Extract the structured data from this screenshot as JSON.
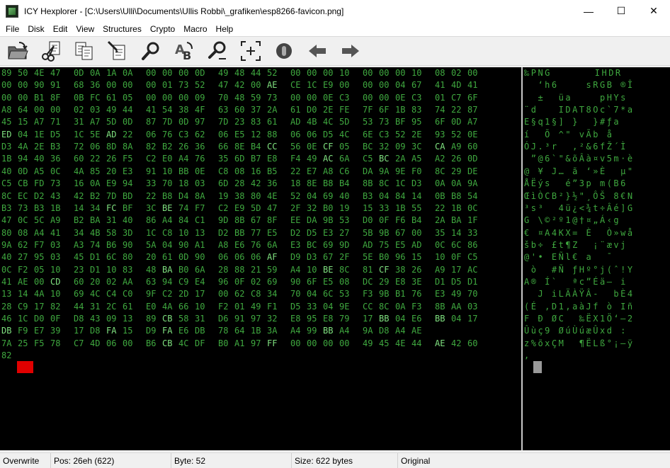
{
  "window": {
    "title": "ICY Hexplorer - [C:\\Users\\Ulli\\Documents\\Ullis Robbi\\_grafiken\\esp8266-favicon.png]",
    "minimize": "—",
    "maximize": "☐",
    "close": "✕"
  },
  "menu": [
    "File",
    "Disk",
    "Edit",
    "View",
    "Structures",
    "Crypto",
    "Macro",
    "Help"
  ],
  "hex_rows": [
    "89 50 4E 47 0D 0A 1A 0A 00 00 00 0D 49 48 44 52 00 00 00 10 00 00 00 10 08 02 00",
    "00 00 90 91 68 36 00 00 00 01 73 52 47 42 00 AE CE 1C E9 00 00 00 04 67 41 4D 41",
    "00 00 B1 8F 0B FC 61 05 00 00 00 09 70 48 59 73 00 00 0E C3 00 00 0E C3 01 C7 6F",
    "A8 64 00 00 02 03 49 44 41 54 38 4F 63 60 37 2A 61 D0 2E FE 7F 6F 1B 83 74 22 87",
    "45 15 A7 71 31 A7 5D 0D 87 7D 0D 97 7D 23 83 61 AD 4B 4C 5D 53 73 BF 95 6F 0D A7",
    "ED 04 1E D5 1C 5E AD 22 06 76 C3 62 06 E5 12 88 06 06 D5 4C 6E C3 52 2E 93 52 0E",
    "D3 4A 2E B3 72 06 8D 8A 82 B2 26 36 66 8E B4 CC 56 0E CF 05 BC 32 09 3C CA A9 60",
    "1B 94 40 36 60 22 26 F5 C2 E0 A4 76 35 6D B7 E8 F4 49 AC 6A C5 BC 2A A5 A2 26 0D",
    "40 0D A5 0C 4A 85 20 E3 91 10 BB 0E C8 08 16 B5 22 E7 A8 C6 DA 9A 9E F0 8C 29 DE",
    "C5 CB FD 73 16 0A E9 94 33 70 18 03 6D 28 42 36 18 8E B8 B4 8B 8C 1C D3 0A 0A 9A",
    "8C EC D2 43 42 B2 7D BD 22 B8 D4 8A 19 38 80 4E 52 04 69 40 B3 04 84 14 0B B8 54",
    "B3 73 B3 1B 14 34 FC BF 3C BE 74 F7 C2 E9 5D 47 2F 32 B0 19 15 33 1B 55 22 1B 0C",
    "47 0C 5C A9 B2 BA 31 40 86 A4 84 C1 9D 8B 67 8F EE DA 9B 53 D0 0F F6 B4 2A BA 1F",
    "80 08 A4 41 34 4B 58 3D 1C C8 10 13 D2 BB 77 E5 D2 D5 E3 27 5B 9B 67 00 35 14 33",
    "9A 62 F7 03 A3 74 B6 90 5A 04 90 A1 A8 E6 76 6A E3 BC 69 9D AD 75 E5 AD 0C 6C 86",
    "40 27 95 03 45 D1 6C 80 20 61 0D 90 06 06 06 AF D9 D3 67 2F 5E B0 96 15 10 0F C5",
    "0C F2 05 10 23 D1 10 83 48 BA B0 6A 28 88 21 59 A4 10 BE 8C 81 CF 38 26 A9 17 AC",
    "41 AE 00 CD 60 20 02 AA 63 94 C9 E4 96 0F 02 69 90 6F E5 08 DC 29 E8 3E D1 D5 D1",
    "13 14 4A 10 69 4C C4 C0 9F C2 2D 17 00 62 C8 34 70 04 6C 53 F3 9B B1 76 E3 49 70",
    "28 C9 17 82 44 31 2C 61 E0 4A 66 10 F2 01 49 F1 D5 33 04 9E CC 8C 0A F3 8B AA 03",
    "46 1C D0 0F D8 43 09 13 89 CB 58 31 D6 91 97 32 E8 95 E8 79 17 BB 04 E6 BB 04 17",
    "DB F9 E7 39 17 D8 FA 15 D9 FA E6 DB 78 64 1B 3A A4 99 BB A4 9A D8 A4 AE",
    "7A 25 F5 78 C7 4D 06 00 B6 CB 4C DF B0 A1 97 FF 00 00 00 00 49 45 4E 44 AE 42 60",
    "82"
  ],
  "ascii_rows": [
    "‰PNG \u001a     IHDR",
    "  ‘h6    sRGB ®Î",
    "  ±  üa    pHYs",
    "¨d   IDAT8Oc`7*a",
    "E§q1§] }  }#ƒa­",
    "í  Õ ^­\" vÃb å ",
    "ÓJ.³r  ‚²&6fŽ´Ì",
    " ”@6`\"&õÂà¤v5m·è",
    "@ ¥ J… ã ‘»È  µ\"",
    "ÅËýs  é”3p m(B6",
    "ŒìÒCB²}½\"¸ÔŠ 8€N",
    "³s³  4ü¿<¾t÷Âé]G",
    "G \\©²º1@†¤„Á‹g",
    "€ ¤A4KX= È  Ò»wå",
    "šb÷ £t¶Z  ¡¨ævj",
    "@'• EÑl€ a  ¯",
    " ò  #Ñ ƒHº°j(ˆ!Y",
    "A® Í`  ªc”Éä– i",
    "  J iLÄÀŸÂ-  bÈ4",
    "(É ‚D1,aàJf ò Iñ",
    "F Ð ØC  ‰ËX1Ö‘—2",
    "Ûùç9 ØúÙúæÛxd :",
    "z%õxÇM  ¶ËLß°¡—ÿ",
    "‚"
  ],
  "status": {
    "mode": "Overwrite",
    "pos": "Pos: 26eh (622)",
    "byte": "Byte: 52",
    "size": "Size: 622 bytes",
    "state": "Original"
  },
  "toolbar": [
    "open-icon",
    "cut-icon",
    "copy-icon",
    "edit-icon",
    "search-icon",
    "replace-icon",
    "find-next-icon",
    "goto-icon",
    "stop-icon",
    "back-arrow-icon",
    "forward-arrow-icon"
  ]
}
